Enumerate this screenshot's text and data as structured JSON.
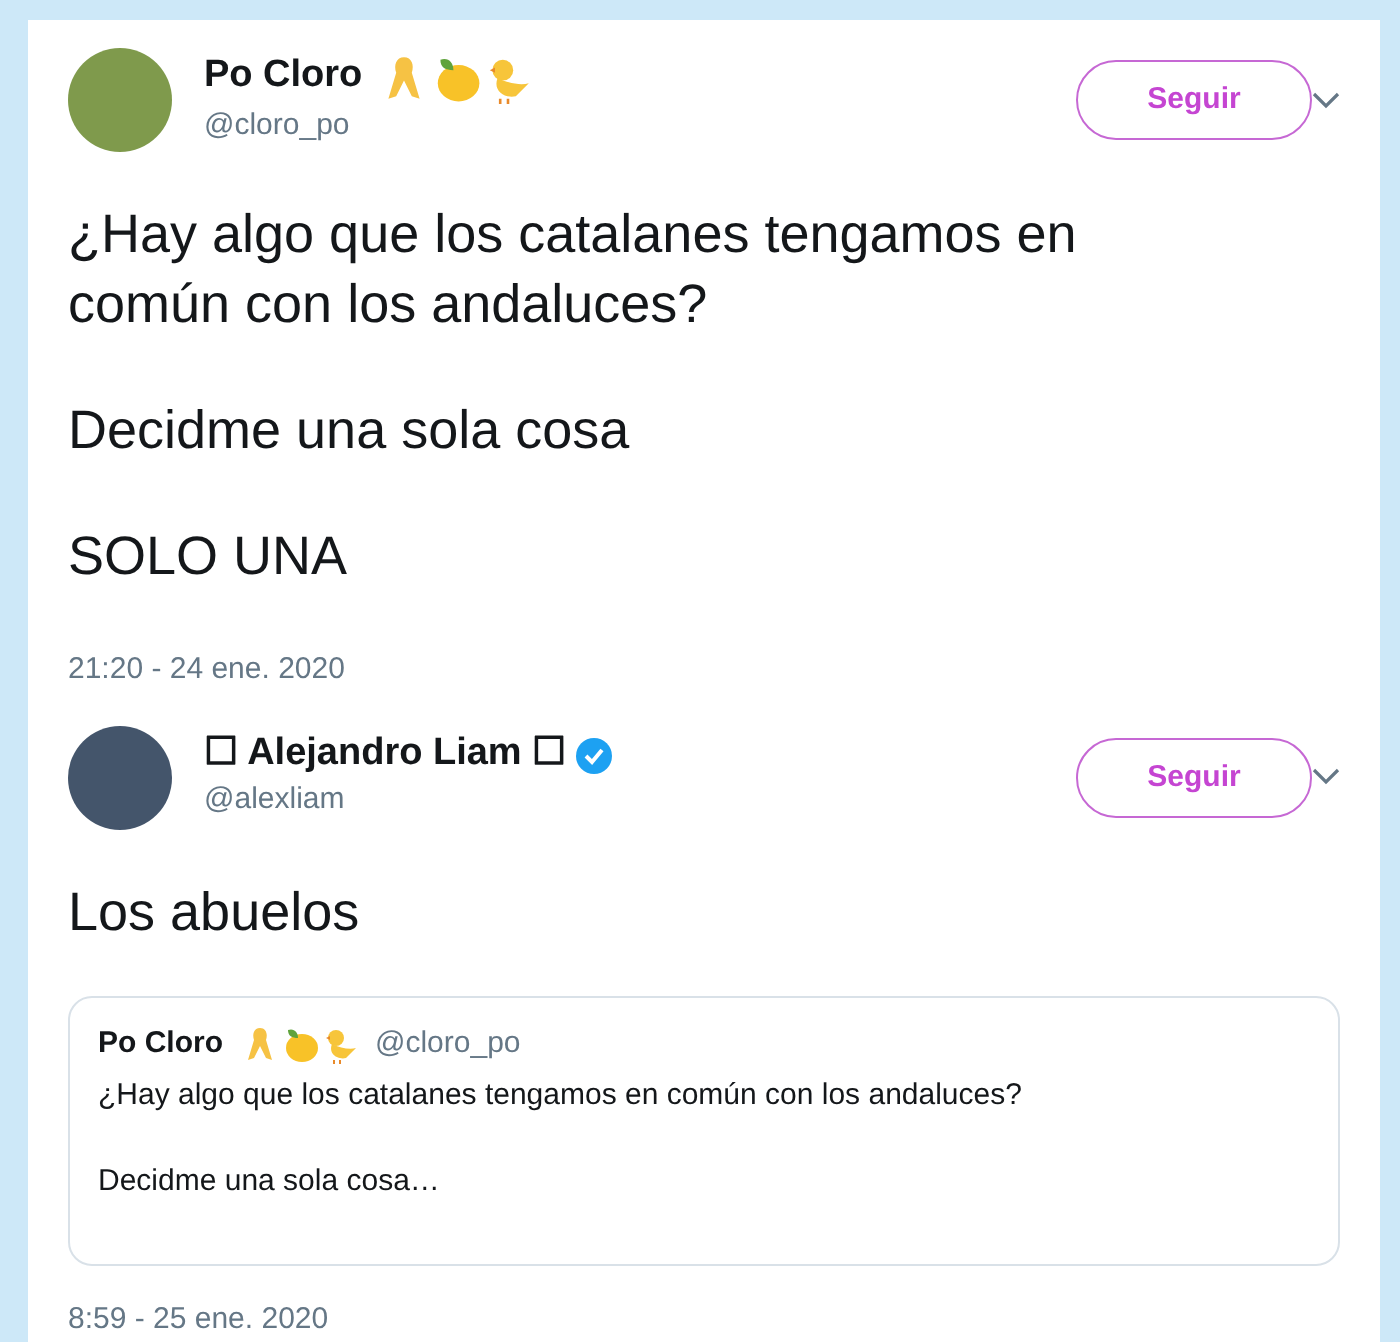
{
  "tweets": [
    {
      "name": "Po Cloro",
      "emoji_badges": true,
      "verified": false,
      "handle": "@cloro_po",
      "follow_button": "Seguir",
      "paragraphs": [
        "¿Hay algo que los catalanes tengamos en común con los andaluces?",
        "Decidme una sola cosa",
        "SOLO UNA"
      ],
      "timestamp": "21:20 - 24 ene. 2020"
    },
    {
      "name": "☐ Alejandro Liam ☐",
      "emoji_badges": false,
      "verified": true,
      "handle": "@alexliam",
      "follow_button": "Seguir",
      "paragraphs": [
        "Los abuelos"
      ],
      "quoted": {
        "name": "Po Cloro",
        "emoji_badges": true,
        "handle": "@cloro_po",
        "paragraphs": [
          "¿Hay algo que los catalanes tengamos en común con los andaluces?",
          "Decidme una sola cosa…"
        ]
      },
      "timestamp": "8:59 - 25 ene. 2020"
    }
  ]
}
